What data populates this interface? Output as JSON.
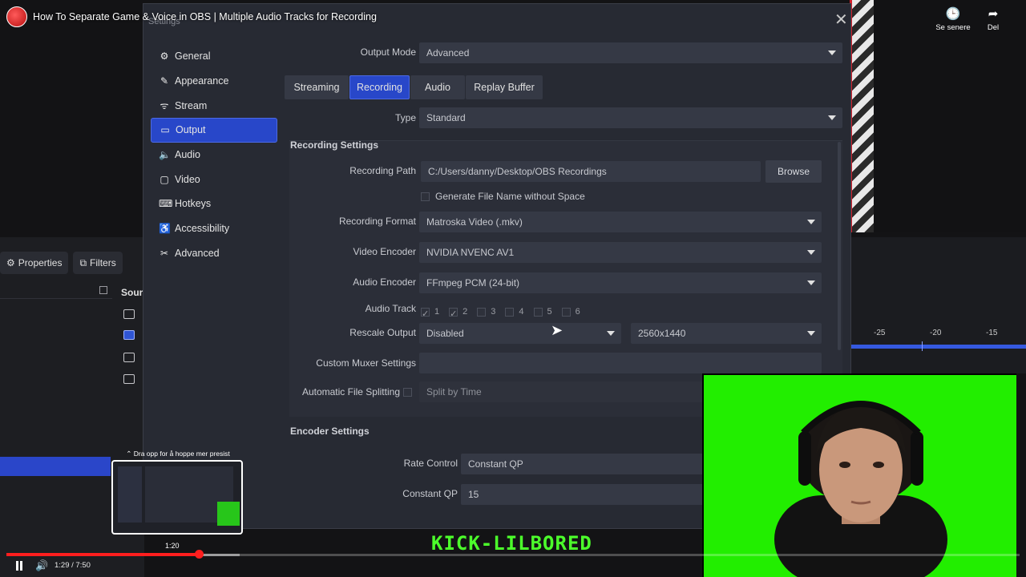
{
  "video": {
    "title": "How To Separate Game & Voice in OBS | Multiple Audio Tracks for Recording",
    "actions": [
      {
        "label": "Se senere",
        "icon": "clock-icon"
      },
      {
        "label": "Del",
        "icon": "share-icon"
      }
    ],
    "time_display": "1:29 / 7:50",
    "progress_fraction": 0.19,
    "buffer_fraction": 0.23,
    "hover_time": "1:20",
    "preview_tip": "⌃ Dra opp for å hoppe mer presist",
    "overlay_text": "KICK-LILBORED"
  },
  "obs_main": {
    "toolbar": {
      "properties_label": "Properties",
      "filters_label": "Filters"
    },
    "sources_title": "Sour",
    "mixer_labels": [
      "-25",
      "-20",
      "-15"
    ]
  },
  "settings": {
    "window_title": "Settings",
    "nav": [
      {
        "label": "General",
        "icon": "gear-icon",
        "glyph": "⚙",
        "active": false
      },
      {
        "label": "Appearance",
        "icon": "brush-icon",
        "glyph": "✎",
        "active": false
      },
      {
        "label": "Stream",
        "icon": "antenna-icon",
        "glyph": "ᯤ",
        "active": false
      },
      {
        "label": "Output",
        "icon": "monitor-icon",
        "glyph": "▭",
        "active": true
      },
      {
        "label": "Audio",
        "icon": "speaker-icon",
        "glyph": "🔈",
        "active": false
      },
      {
        "label": "Video",
        "icon": "screen-icon",
        "glyph": "▢",
        "active": false
      },
      {
        "label": "Hotkeys",
        "icon": "keyboard-icon",
        "glyph": "⌨",
        "active": false
      },
      {
        "label": "Accessibility",
        "icon": "accessibility-icon",
        "glyph": "♿",
        "active": false
      },
      {
        "label": "Advanced",
        "icon": "tools-icon",
        "glyph": "✂",
        "active": false
      }
    ],
    "output_mode": {
      "label": "Output Mode",
      "value": "Advanced"
    },
    "tabs": [
      "Streaming",
      "Recording",
      "Audio",
      "Replay Buffer"
    ],
    "active_tab": "Recording",
    "type": {
      "label": "Type",
      "value": "Standard"
    },
    "recording": {
      "title": "Recording Settings",
      "path_label": "Recording Path",
      "path_value": "C:/Users/danny/Desktop/OBS Recordings",
      "browse_label": "Browse",
      "no_space_label": "Generate File Name without Space",
      "format_label": "Recording Format",
      "format_value": "Matroska Video (.mkv)",
      "video_encoder_label": "Video Encoder",
      "video_encoder_value": "NVIDIA NVENC AV1",
      "audio_encoder_label": "Audio Encoder",
      "audio_encoder_value": "FFmpeg PCM (24-bit)",
      "audio_track_label": "Audio Track",
      "audio_tracks": [
        {
          "num": "1",
          "checked": true
        },
        {
          "num": "2",
          "checked": true
        },
        {
          "num": "3",
          "checked": false
        },
        {
          "num": "4",
          "checked": false
        },
        {
          "num": "5",
          "checked": false
        },
        {
          "num": "6",
          "checked": false
        }
      ],
      "rescale_label": "Rescale Output",
      "rescale_value": "Disabled",
      "rescale_resolution": "2560x1440",
      "muxer_label": "Custom Muxer Settings",
      "muxer_value": "",
      "split_label": "Automatic File Splitting",
      "split_value": "Split by Time"
    },
    "encoder": {
      "title": "Encoder Settings",
      "rate_control_label": "Rate Control",
      "rate_control_value": "Constant QP",
      "cqp_label": "Constant QP",
      "cqp_value": "15"
    }
  }
}
